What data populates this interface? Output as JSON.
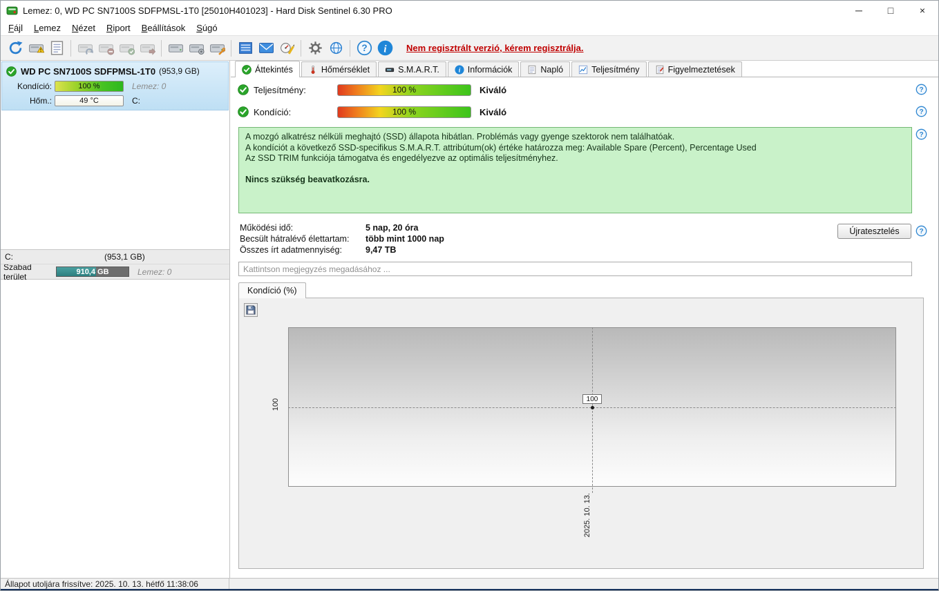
{
  "window": {
    "title": "Lemez: 0, WD PC SN7100S SDFPMSL-1T0 [25010H401023]  -  Hard Disk Sentinel 6.30 PRO",
    "controls": {
      "minimize": "─",
      "maximize": "□",
      "close": "×"
    }
  },
  "menu": {
    "items": [
      "Fájl",
      "Lemez",
      "Nézet",
      "Riport",
      "Beállítások",
      "Súgó"
    ]
  },
  "toolbar": {
    "register_link": "Nem regisztrált verzió, kérem regisztrálja.",
    "icons": [
      "refresh",
      "disk-alert",
      "report",
      "disk-undo",
      "disk-remove",
      "disk-accept",
      "disk-eject",
      "disk",
      "disk-gear",
      "disk-tools",
      "surface-test",
      "email",
      "benchmark",
      "settings-gear",
      "online",
      "help",
      "info"
    ]
  },
  "sidebar": {
    "disk": {
      "name": "WD PC SN7100S SDFPMSL-1T0",
      "size": "(953,9 GB)",
      "condition_label": "Kondíció:",
      "condition_value": "100 %",
      "disk_number": "Lemez: 0",
      "temp_label": "Hőm.:",
      "temp_value": "49 °C",
      "drive_letter": "C:"
    },
    "partition": {
      "drive_letter": "C:",
      "size": "(953,1 GB)",
      "free_label": "Szabad terület",
      "free_value": "910,4 GB",
      "disk_number": "Lemez: 0"
    }
  },
  "tabs": {
    "items": [
      "Áttekintés",
      "Hőmérséklet",
      "S.M.A.R.T.",
      "Információk",
      "Napló",
      "Teljesítmény",
      "Figyelmeztetések"
    ]
  },
  "overview": {
    "performance": {
      "label": "Teljesítmény:",
      "value": "100 %",
      "rating": "Kiváló"
    },
    "condition": {
      "label": "Kondíció:",
      "value": "100 %",
      "rating": "Kiváló"
    },
    "health_lines": [
      "A mozgó alkatrész nélküli meghajtó (SSD) állapota hibátlan. Problémás vagy gyenge szektorok nem találhatóak.",
      "A kondíciót a következő SSD-specifikus S.M.A.R.T. attribútum(ok) értéke határozza meg:  Available Spare (Percent), Percentage Used",
      "Az SSD TRIM funkciója támogatva és engedélyezve az optimális teljesítményhez."
    ],
    "health_action": "Nincs szükség beavatkozásra.",
    "stats": [
      {
        "label": "Működési idő:",
        "value": "5 nap, 20 óra"
      },
      {
        "label": "Becsült hátralévő élettartam:",
        "value": "több mint 1000 nap"
      },
      {
        "label": "Összes írt adatmennyiség:",
        "value": "9,47 TB"
      }
    ],
    "retest_button": "Újratesztelés",
    "comment_placeholder": "Kattintson megjegyzés megadásához ..."
  },
  "chart": {
    "tab_label": "Kondíció  (%)",
    "y_tick": "100",
    "point_label": "100",
    "x_tick": "2025. 10. 13."
  },
  "chart_data": {
    "type": "line",
    "title": "Kondíció (%)",
    "x": [
      "2025. 10. 13."
    ],
    "series": [
      {
        "name": "Kondíció",
        "values": [
          100
        ]
      }
    ],
    "ylabel": "Kondíció (%)",
    "legend": "none",
    "grid": "dashed crosshair at data point"
  },
  "statusbar": {
    "text": "Állapot utoljára frissítve: 2025. 10. 13. hétfő 11:38:06"
  }
}
